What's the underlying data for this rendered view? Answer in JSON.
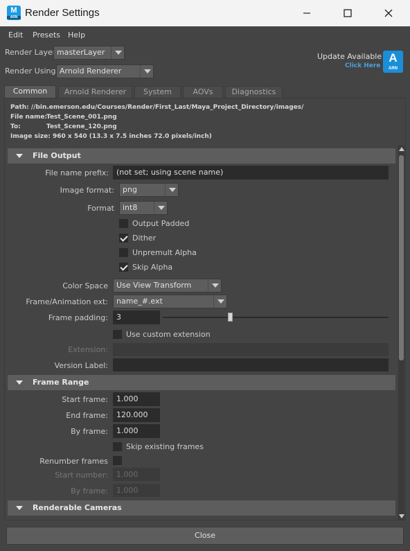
{
  "window": {
    "title": "Render Settings",
    "icon_letter": "M",
    "icon_sub": "ARN"
  },
  "menu": [
    "Edit",
    "Presets",
    "Help"
  ],
  "render_layer": {
    "label": "Render Layer",
    "value": "masterLayer"
  },
  "render_using": {
    "label": "Render Using",
    "value": "Arnold Renderer"
  },
  "update": {
    "text": "Update Available",
    "link": "Click Here",
    "logo_letter": "A",
    "logo_sub": "ARN"
  },
  "tabs": [
    "Common",
    "Arnold Renderer",
    "System",
    "AOVs",
    "Diagnostics"
  ],
  "info": {
    "path": "Path: //bin.emerson.edu/Courses/Render/First_Last/Maya_Project_Directory/images/",
    "file_name_label": "File name:",
    "file_name": "Test_Scene_001.png",
    "to_label": "To:",
    "to": "Test_Scene_120.png",
    "image_size": "Image size: 960 x 540 (13.3 x 7.5 inches 72.0 pixels/inch)"
  },
  "file_output": {
    "header": "File Output",
    "prefix_label": "File name prefix:",
    "prefix_value": "(not set; using scene name)",
    "image_format_label": "Image format:",
    "image_format": "png",
    "format_label": "Format",
    "format": "int8",
    "output_padded": "Output Padded",
    "dither": "Dither",
    "unpremult_alpha": "Unpremult Alpha",
    "skip_alpha": "Skip Alpha",
    "color_space_label": "Color Space",
    "color_space": "Use View Transform",
    "frame_ext_label": "Frame/Animation ext:",
    "frame_ext": "name_#.ext",
    "frame_padding_label": "Frame padding:",
    "frame_padding": "3",
    "frame_padding_slider": 0.3,
    "use_custom_ext": "Use custom extension",
    "extension_label": "Extension:",
    "version_label": "Version Label:"
  },
  "frame_range": {
    "header": "Frame Range",
    "start_label": "Start frame:",
    "start": "1.000",
    "end_label": "End frame:",
    "end": "120.000",
    "by_label": "By frame:",
    "by": "1.000",
    "skip_existing": "Skip existing frames",
    "renumber_label": "Renumber frames",
    "start_number_label": "Start number:",
    "start_number": "1.000",
    "by_frame2_label": "By frame:",
    "by_frame2": "1.000"
  },
  "renderable_cameras": {
    "header": "Renderable Cameras"
  },
  "close_label": "Close"
}
